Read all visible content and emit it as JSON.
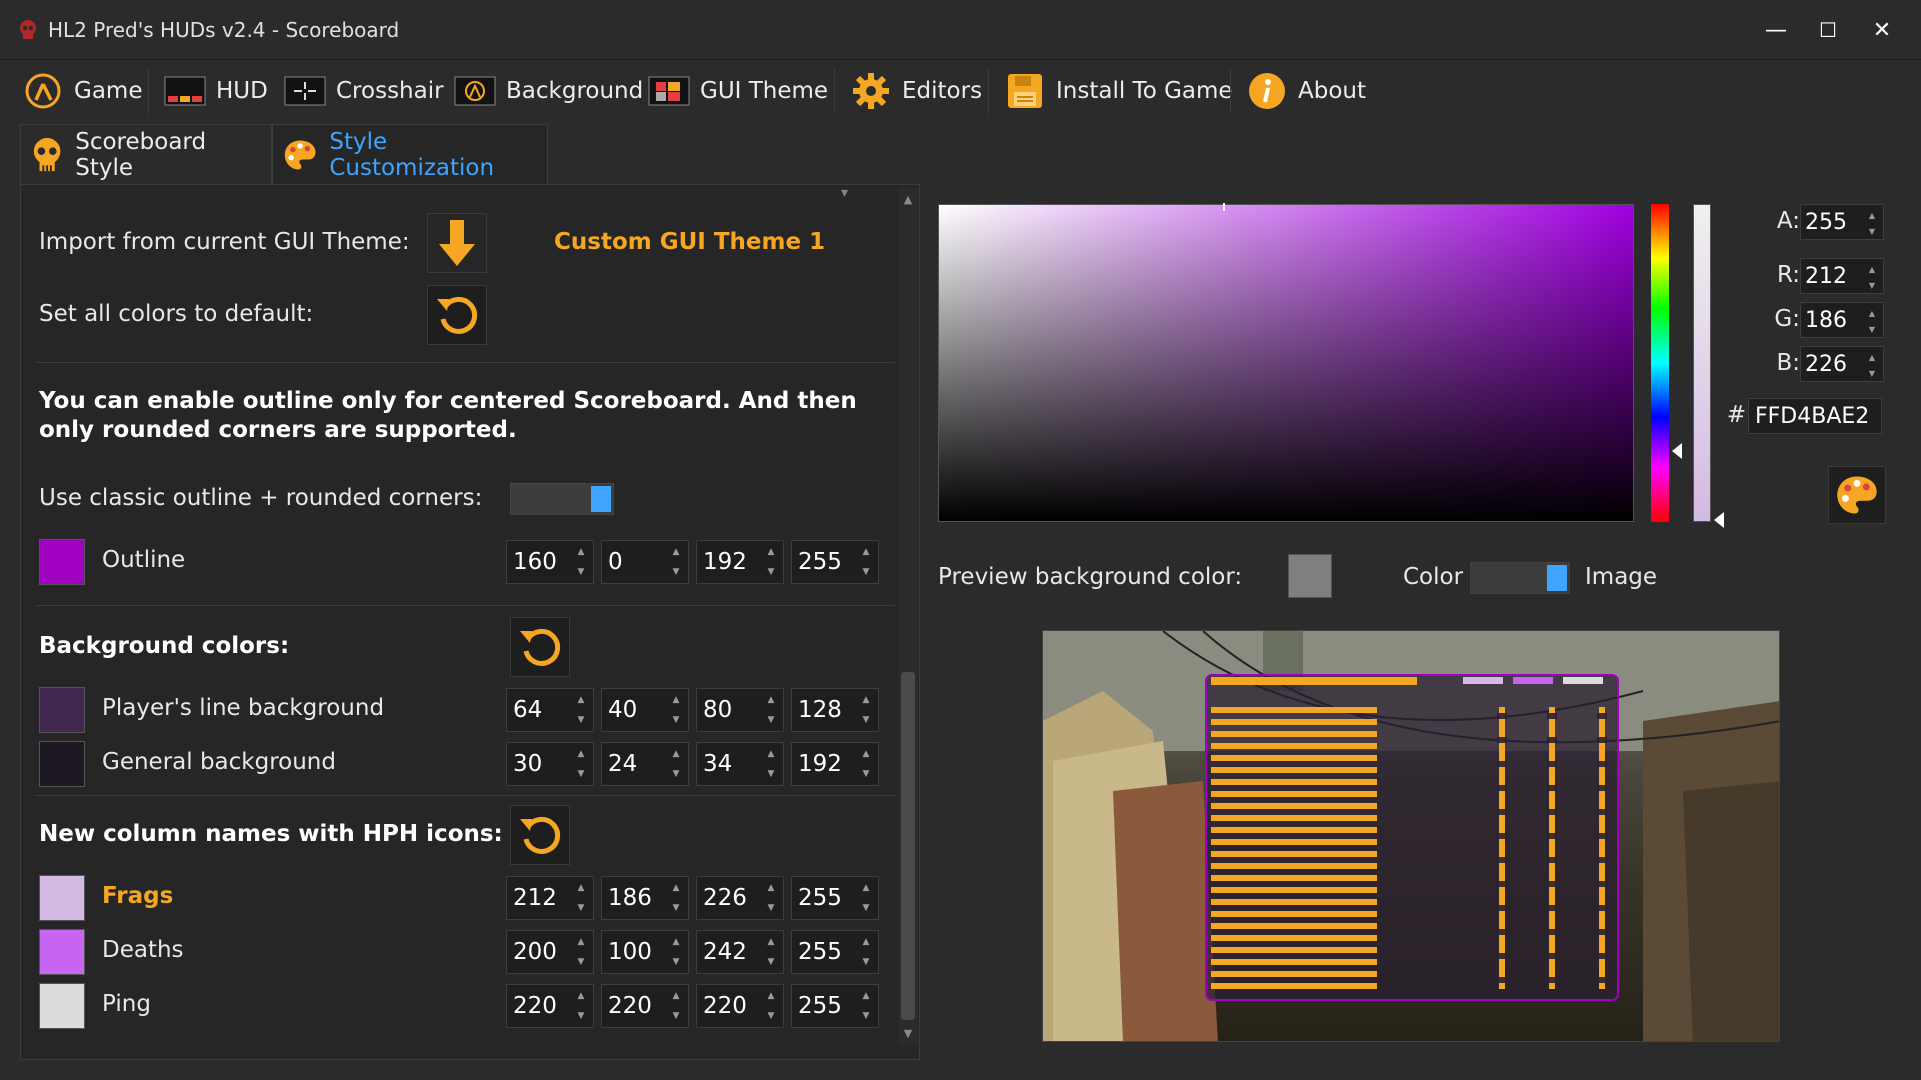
{
  "window": {
    "title": "HL2 Pred's HUDs v2.4 - Scoreboard",
    "minimize": "—",
    "maximize": "☐",
    "close": "✕"
  },
  "menu": {
    "items": [
      {
        "label": "Game",
        "icon": "half-life-lambda-icon"
      },
      {
        "label": "HUD",
        "icon": "hud-icon"
      },
      {
        "label": "Crosshair",
        "icon": "crosshair-icon"
      },
      {
        "label": "Background",
        "icon": "background-icon"
      },
      {
        "label": "GUI Theme",
        "icon": "gui-theme-icon"
      },
      {
        "label": "Editors",
        "icon": "gear-icon"
      },
      {
        "label": "Install To Game",
        "icon": "floppy-disk-icon"
      },
      {
        "label": "About",
        "icon": "info-icon"
      }
    ]
  },
  "subtabs": [
    {
      "label": "Scoreboard Style",
      "icon": "skull-icon"
    },
    {
      "label": "Style Customization",
      "icon": "palette-icon"
    }
  ],
  "left": {
    "import_label": "Import from current GUI Theme:",
    "theme_name": "Custom GUI Theme 1",
    "default_label": "Set all colors to default:",
    "outline_note": "You can enable outline only for centered Scoreboard. And then only rounded corners are supported.",
    "classic_outline_label": "Use classic outline + rounded corners:",
    "outline": {
      "label": "Outline",
      "color": "#A000C0",
      "rgba": [
        "160",
        "0",
        "192",
        "255"
      ]
    },
    "bg_header": "Background colors:",
    "players_line": {
      "label": "Player's line background",
      "color": "#402850",
      "rgba": [
        "64",
        "40",
        "80",
        "128"
      ]
    },
    "general_bg": {
      "label": "General background",
      "color": "#1E1822",
      "rgba": [
        "30",
        "24",
        "34",
        "192"
      ]
    },
    "columns_header": "New column names with HPH icons:",
    "frags": {
      "label": "Frags",
      "color": "#D4BAE2",
      "rgba": [
        "212",
        "186",
        "226",
        "255"
      ]
    },
    "deaths": {
      "label": "Deaths",
      "color": "#C864F2",
      "rgba": [
        "200",
        "100",
        "242",
        "255"
      ]
    },
    "ping": {
      "label": "Ping",
      "color": "#DCDCDC",
      "rgba": [
        "220",
        "220",
        "220",
        "255"
      ]
    }
  },
  "picker": {
    "a_label": "A:",
    "a": "255",
    "r_label": "R:",
    "r": "212",
    "g_label": "G:",
    "g": "186",
    "b_label": "B:",
    "b": "226",
    "hex_prefix": "#",
    "hex": "FFD4BAE2"
  },
  "preview": {
    "bg_label": "Preview background color:",
    "bg_swatch": "#808080",
    "color_label": "Color",
    "image_label": "Image"
  },
  "colors": {
    "accent": "#3DA5FF",
    "orange": "#F5A623"
  }
}
